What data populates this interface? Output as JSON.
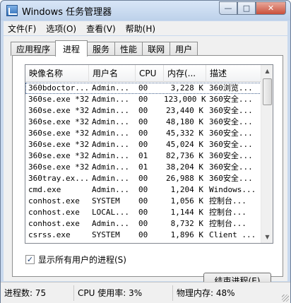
{
  "window": {
    "title": "Windows 任务管理器"
  },
  "title_buttons": {
    "minimize": "—",
    "maximize": "□",
    "close": "✕"
  },
  "menu": [
    "文件(F)",
    "选项(O)",
    "查看(V)",
    "帮助(H)"
  ],
  "tabs": [
    {
      "label": "应用程序",
      "active": false
    },
    {
      "label": "进程",
      "active": true
    },
    {
      "label": "服务",
      "active": false
    },
    {
      "label": "性能",
      "active": false
    },
    {
      "label": "联网",
      "active": false
    },
    {
      "label": "用户",
      "active": false
    }
  ],
  "columns": [
    "映像名称",
    "用户名",
    "CPU",
    "内存(...",
    "描述"
  ],
  "processes": [
    {
      "name": "360bdoctor....",
      "user": "Admin...",
      "cpu": "00",
      "mem": "3,228 K",
      "desc": "360浏览..."
    },
    {
      "name": "360se.exe *32",
      "user": "Admin...",
      "cpu": "00",
      "mem": "123,000 K",
      "desc": "360安全..."
    },
    {
      "name": "360se.exe *32",
      "user": "Admin...",
      "cpu": "00",
      "mem": "23,440 K",
      "desc": "360安全..."
    },
    {
      "name": "360se.exe *32",
      "user": "Admin...",
      "cpu": "00",
      "mem": "48,180 K",
      "desc": "360安全..."
    },
    {
      "name": "360se.exe *32",
      "user": "Admin...",
      "cpu": "00",
      "mem": "45,332 K",
      "desc": "360安全..."
    },
    {
      "name": "360se.exe *32",
      "user": "Admin...",
      "cpu": "00",
      "mem": "45,024 K",
      "desc": "360安全..."
    },
    {
      "name": "360se.exe *32",
      "user": "Admin...",
      "cpu": "01",
      "mem": "82,736 K",
      "desc": "360安全..."
    },
    {
      "name": "360se.exe *32",
      "user": "Admin...",
      "cpu": "01",
      "mem": "38,204 K",
      "desc": "360安全..."
    },
    {
      "name": "360tray.ex...",
      "user": "Admin...",
      "cpu": "00",
      "mem": "26,988 K",
      "desc": "360安全..."
    },
    {
      "name": "cmd.exe",
      "user": "Admin...",
      "cpu": "00",
      "mem": "1,204 K",
      "desc": "Windows..."
    },
    {
      "name": "conhost.exe",
      "user": "SYSTEM",
      "cpu": "00",
      "mem": "1,056 K",
      "desc": "控制台..."
    },
    {
      "name": "conhost.exe",
      "user": "LOCAL...",
      "cpu": "00",
      "mem": "1,144 K",
      "desc": "控制台..."
    },
    {
      "name": "conhost.exe",
      "user": "Admin...",
      "cpu": "00",
      "mem": "8,732 K",
      "desc": "控制台..."
    },
    {
      "name": "csrss.exe",
      "user": "SYSTEM",
      "cpu": "00",
      "mem": "1,896 K",
      "desc": "Client ..."
    },
    {
      "name": "csrss.exe",
      "user": "SYSTEM",
      "cpu": "00",
      "mem": "3,732 K",
      "desc": "Client ..."
    }
  ],
  "show_all_users": {
    "label": "显示所有用户的进程(S)",
    "checked": true
  },
  "end_process_button": "结束进程(E)",
  "status": {
    "processes": "进程数: 75",
    "cpu": "CPU 使用率: 3%",
    "memory": "物理内存: 48%"
  }
}
